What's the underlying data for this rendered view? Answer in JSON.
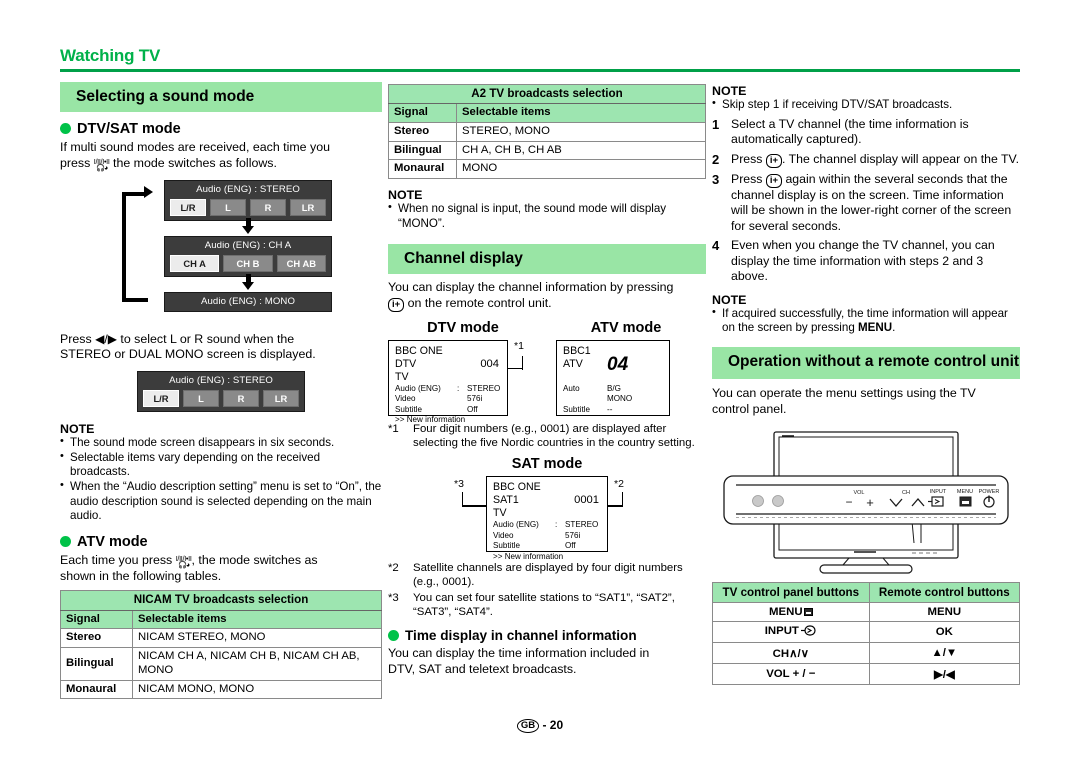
{
  "runhead": {
    "title": "Watching TV"
  },
  "footer": {
    "locale": "GB",
    "separator": "-",
    "page": "20"
  },
  "col1": {
    "section_title": "Selecting a sound mode",
    "dtv_head": "DTV/SAT mode",
    "dtv_text_a": "If multi sound modes are received, each time you",
    "dtv_text_b": "press",
    "dtv_text_c": "the mode switches as follows.",
    "osd": {
      "box1": {
        "title": "Audio (ENG)  :  STEREO",
        "cells": [
          "L/R",
          "L",
          "R",
          "LR"
        ]
      },
      "box2": {
        "title": "Audio (ENG)  : CH A",
        "cells": [
          "CH A",
          "CH B",
          "CH AB"
        ]
      },
      "box3": {
        "title": "Audio (ENG)  :  MONO"
      },
      "box4": {
        "title": "Audio (ENG)  :  STEREO",
        "cells": [
          "L/R",
          "L",
          "R",
          "LR"
        ]
      }
    },
    "press_text_a": "Press",
    "press_arrows": "◀/▶",
    "press_text_b": "to select L or R sound when the",
    "press_text_c": "STEREO or DUAL MONO screen is displayed.",
    "note_head": "NOTE",
    "notes": [
      "The sound mode screen disappears in six seconds.",
      "Selectable items vary depending on the received broadcasts.",
      "When the “Audio description setting” menu is set to “On”, the audio description sound is selected depending on the main audio."
    ],
    "atv_head": "ATV mode",
    "atv_text_a": "Each time you press",
    "atv_text_b": ", the mode switches as",
    "atv_text_c": "shown in the following tables.",
    "nicam_table": {
      "caption": "NICAM TV broadcasts selection",
      "headers": [
        "Signal",
        "Selectable items"
      ],
      "rows": [
        [
          "Stereo",
          "NICAM STEREO, MONO"
        ],
        [
          "Bilingual",
          "NICAM CH A, NICAM CH B, NICAM CH AB, MONO"
        ],
        [
          "Monaural",
          "NICAM MONO, MONO"
        ]
      ]
    }
  },
  "col2": {
    "a2_table": {
      "caption": "A2 TV broadcasts selection",
      "headers": [
        "Signal",
        "Selectable items"
      ],
      "rows": [
        [
          "Stereo",
          "STEREO, MONO"
        ],
        [
          "Bilingual",
          "CH A, CH B, CH AB"
        ],
        [
          "Monaural",
          "MONO"
        ]
      ]
    },
    "note_head": "NOTE",
    "notes": [
      "When no signal is input, the sound mode will display “MONO”."
    ],
    "section_title": "Channel display",
    "intro_a": "You can display the channel information by pressing",
    "intro_b": "on the remote control unit.",
    "dtv_mode_title": "DTV mode",
    "atv_mode_title": "ATV mode",
    "sat_mode_title": "SAT mode",
    "dtv_screen": {
      "name": "BBC ONE",
      "type": "DTV",
      "tv": "TV",
      "number": "004",
      "mark": "*1",
      "rows": [
        [
          "Audio (ENG)",
          ":",
          "STEREO"
        ],
        [
          "Video",
          "",
          "576i"
        ],
        [
          "Subtitle",
          "",
          "Off"
        ]
      ],
      "newinfo": ">> New information"
    },
    "atv_screen": {
      "name": "BBC1",
      "type": "ATV",
      "number": "04",
      "rows": [
        [
          "Auto",
          "B/G"
        ],
        [
          "",
          "MONO"
        ],
        [
          "Subtitle",
          "--"
        ]
      ]
    },
    "sat_screen": {
      "name": "BBC ONE",
      "type": "SAT1",
      "tv": "TV",
      "number": "0001",
      "mark_left": "*3",
      "mark_right": "*2",
      "rows": [
        [
          "Audio (ENG)",
          ":",
          "STEREO"
        ],
        [
          "Video",
          "",
          "576i"
        ],
        [
          "Subtitle",
          "",
          "Off"
        ]
      ],
      "newinfo": ">> New information"
    },
    "footnotes": [
      {
        "mark": "*1",
        "text": "Four digit numbers (e.g., 0001) are displayed after selecting the five Nordic countries in the country setting."
      },
      {
        "mark": "*2",
        "text": "Satellite channels are displayed by four digit numbers (e.g., 0001)."
      },
      {
        "mark": "*3",
        "text": "You can set four satellite stations to “SAT1”, “SAT2”, “SAT3”, “SAT4”."
      }
    ],
    "time_head": "Time display in channel information",
    "time_text_a": "You can display the time information included in",
    "time_text_b": "DTV, SAT and teletext broadcasts."
  },
  "col3": {
    "note_head_1": "NOTE",
    "notes_1": [
      "Skip step 1 if receiving DTV/SAT broadcasts."
    ],
    "steps": [
      {
        "n": "1",
        "text": "Select a TV channel (the time information is automatically captured)."
      },
      {
        "n": "2",
        "pre": "Press",
        "post": ". The channel display will appear on the TV."
      },
      {
        "n": "3",
        "pre": "Press",
        "post": "again within the several seconds that the channel display is on the screen. Time information will be shown in the lower-right corner of the screen for several seconds."
      },
      {
        "n": "4",
        "text": "Even when you change the TV channel, you can display the time information with steps 2 and 3 above."
      }
    ],
    "note_head_2": "NOTE",
    "notes_2_a": "If acquired successfully, the time information will appear on the screen by pressing",
    "notes_2_bold": "MENU",
    "notes_2_b": ".",
    "section_title": "Operation without a remote control unit",
    "intro_a": "You can operate the menu settings using the TV",
    "intro_b": "control panel.",
    "panel_labels": {
      "vol": "VOL",
      "ch": "CH",
      "input": "INPUT",
      "menu": "MENU",
      "power": "POWER",
      "minus": "−",
      "plus": "+"
    },
    "map_table": {
      "headers": [
        "TV control panel buttons",
        "Remote control buttons"
      ],
      "rows": [
        [
          "MENU",
          "MENU"
        ],
        [
          "INPUT",
          "OK"
        ],
        [
          "CH∧/∨",
          "▲/▼"
        ],
        [
          "VOL + / −",
          "▶/◀"
        ]
      ]
    }
  },
  "colors": {
    "accent_green": "#00b14a",
    "bar_green": "#99e5a5",
    "table_green": "#9de5b0",
    "osd_bg": "#3c3c3c"
  }
}
